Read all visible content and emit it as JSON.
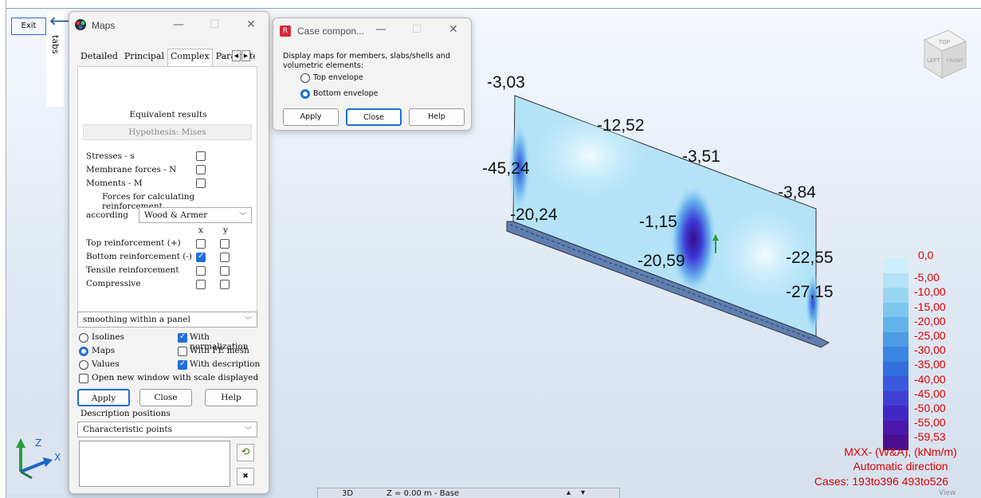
{
  "app": {
    "exit_label": "Exit",
    "tabs_label": "tabs"
  },
  "maps_dialog": {
    "title": "Maps",
    "tabs": [
      "Detailed",
      "Principal",
      "Complex",
      "Parameter"
    ],
    "active_tab": "Complex",
    "section_title": "Equivalent results",
    "hypothesis": "Hypothesis: Mises",
    "stresses_label": "Stresses - s",
    "membrane_label": "Membrane forces - N",
    "moments_label": "Moments - M",
    "forces_label": "Forces for calculating reinforcement",
    "according_label": "according",
    "according_value": "Wood & Armer",
    "x_header": "x",
    "y_header": "y",
    "top_reinf": "Top reinforcement (+)",
    "bottom_reinf": "Bottom reinforcement (-)",
    "tensile_reinf": "Tensile reinforcement",
    "compressive": "Compressive",
    "smoothing": "smoothing within a panel",
    "isolines": "Isolines",
    "maps": "Maps",
    "values": "Values",
    "with_normalization": "With normalization",
    "with_fe_mesh": "With FE mesh",
    "with_description": "With description",
    "open_new_window": "Open new window with scale displayed",
    "apply": "Apply",
    "close": "Close",
    "help": "Help",
    "description_positions": "Description positions",
    "characteristic_points": "Characteristic points"
  },
  "case_dialog": {
    "title": "Case compon...",
    "icon_letter": "R",
    "description": "Display maps for members, slabs/shells and volumetric elements:",
    "top_envelope": "Top envelope",
    "bottom_envelope": "Bottom envelope",
    "apply": "Apply",
    "close": "Close",
    "help": "Help"
  },
  "values_3d": {
    "v1": "-3,03",
    "v2": "-12,52",
    "v3": "-3,51",
    "v4": "-3,84",
    "v5": "-45,24",
    "v6": "-20,24",
    "v7": "-1,15",
    "v8": "-20,59",
    "v9": "-22,55",
    "v10": "-27,15"
  },
  "legend": {
    "values": [
      "0,0",
      "-5,00",
      "-10,00",
      "-15,00",
      "-20,00",
      "-25,00",
      "-30,00",
      "-35,00",
      "-40,00",
      "-45,00",
      "-50,00",
      "-55,00",
      "-59,53"
    ],
    "colors": [
      "#cdeefb",
      "#b4e3f7",
      "#99d6f2",
      "#7dc6ee",
      "#62b3ea",
      "#4c9ce6",
      "#3c84e2",
      "#3370de",
      "#3a58dc",
      "#3f3fd6",
      "#4128c4",
      "#4a17ab",
      "#4b0e8c"
    ]
  },
  "info": {
    "line1": "MXX- (W&A), (kNm/m)",
    "line2": "Automatic direction",
    "line3": "Cases: 193to396 493to526"
  },
  "viewcube": {
    "top": "TOP",
    "left": "LEFT",
    "front": "FRONT"
  },
  "status": {
    "mode": "3D",
    "level": "Z = 0.00 m - Base",
    "view": "View"
  }
}
